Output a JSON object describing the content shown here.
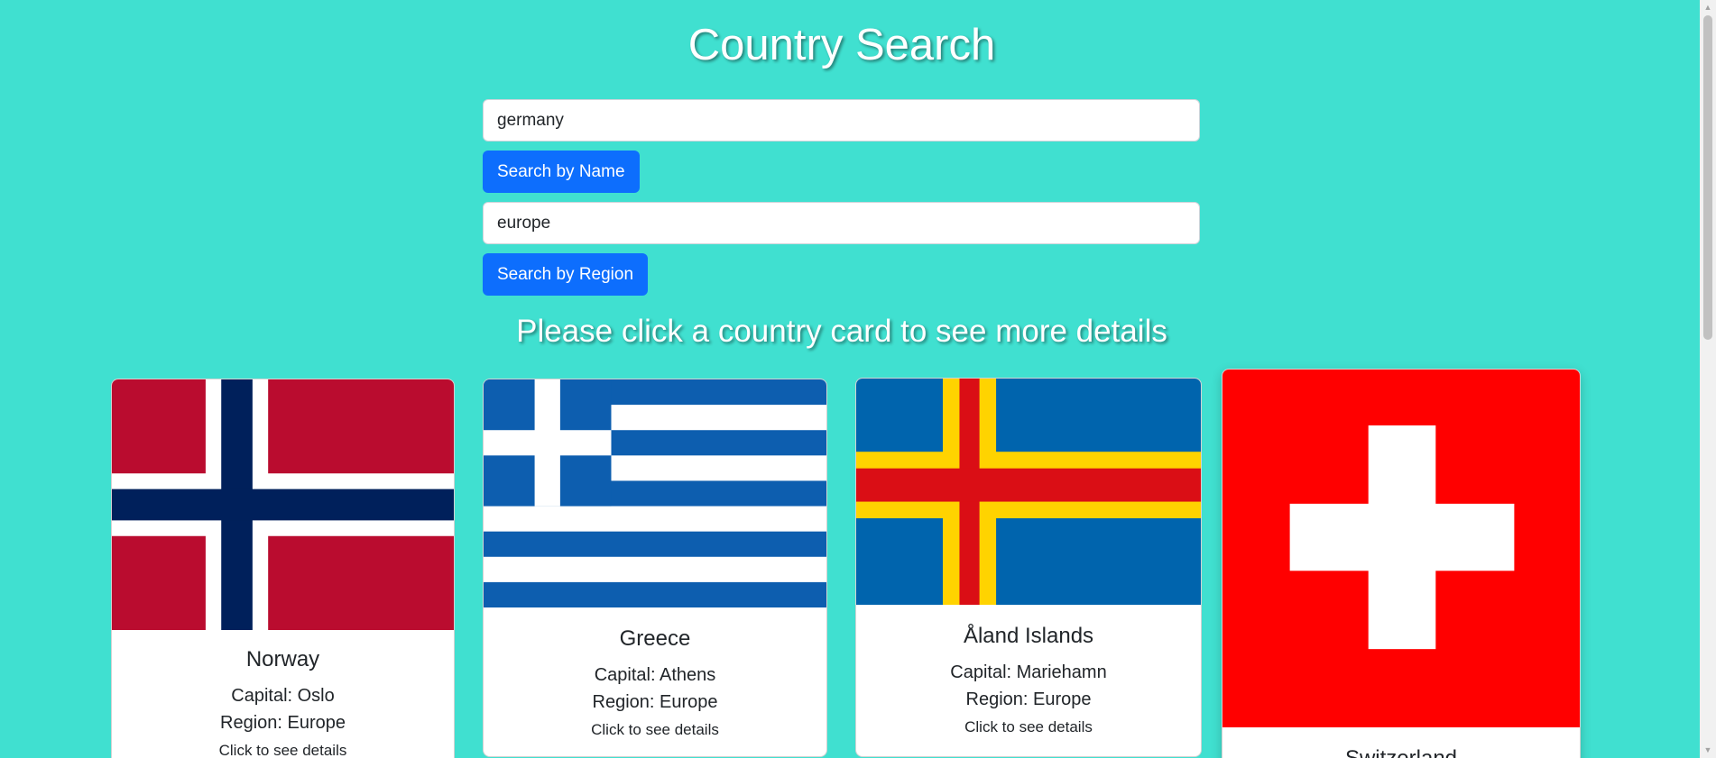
{
  "title": "Country Search",
  "search": {
    "name_value": "germany",
    "name_button": "Search by Name",
    "region_value": "europe",
    "region_button": "Search by Region"
  },
  "hint": "Please click a country card to see more details",
  "colors": {
    "background": "#40e0d0",
    "primary_button": "#0d6efd"
  },
  "cards": [
    {
      "name": "Norway",
      "capital": "Capital: Oslo",
      "region": "Region: Europe",
      "cta": "Click to see details",
      "flag": "norway-flag"
    },
    {
      "name": "Greece",
      "capital": "Capital: Athens",
      "region": "Region: Europe",
      "cta": "Click to see details",
      "flag": "greece-flag"
    },
    {
      "name": "Åland Islands",
      "capital": "Capital: Mariehamn",
      "region": "Region: Europe",
      "cta": "Click to see details",
      "flag": "aland-flag"
    },
    {
      "name": "Switzerland",
      "flag": "switzerland-flag"
    }
  ]
}
